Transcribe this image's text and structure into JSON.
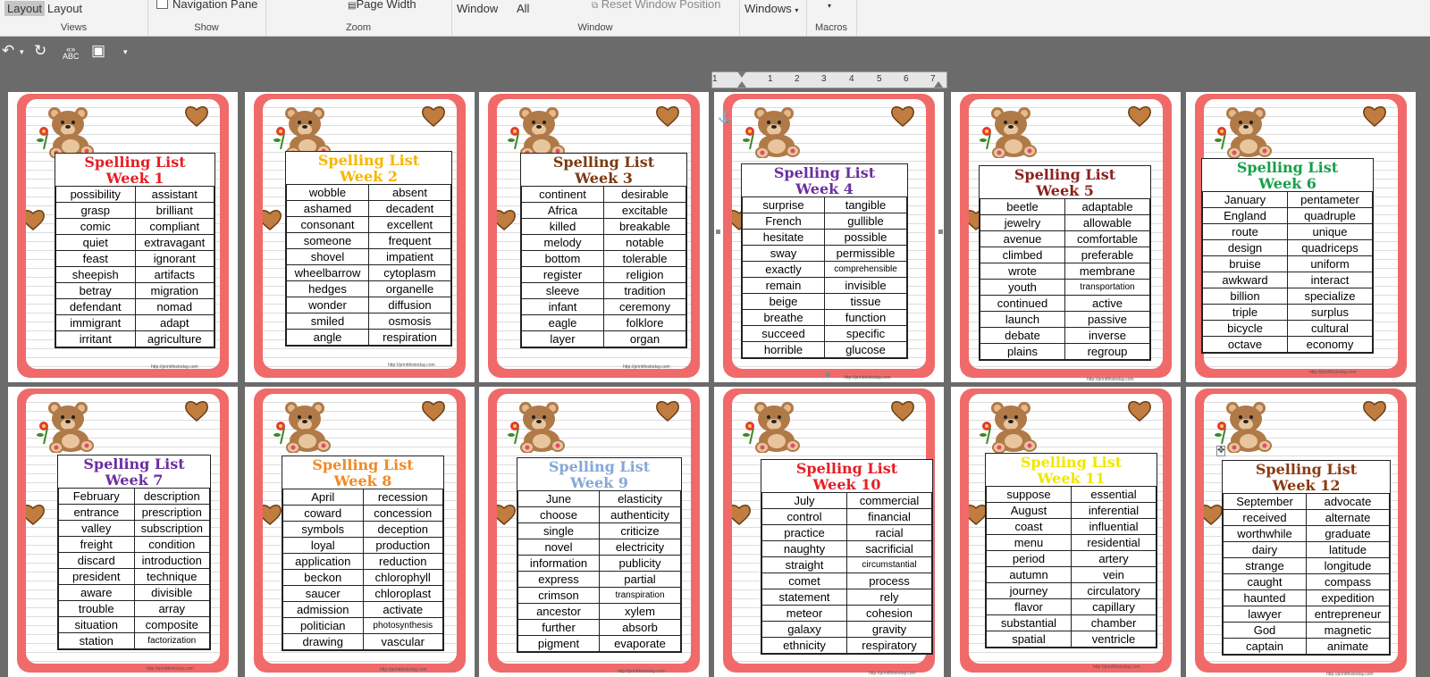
{
  "ribbon": {
    "views": {
      "label": "Views",
      "items": [
        "Layout",
        "Layout"
      ]
    },
    "show": {
      "label": "Show",
      "item": "Navigation Pane"
    },
    "zoom": {
      "label": "Zoom",
      "item": "Page Width"
    },
    "window": {
      "label": "Window",
      "items": [
        "Window",
        "All",
        "Reset Window Position"
      ]
    },
    "windows": {
      "label": "Windows"
    },
    "macros": {
      "label": "Macros"
    }
  },
  "qat": {
    "icons": [
      "undo-icon",
      "redo-icon",
      "spelling-icon",
      "paste-icon"
    ]
  },
  "ruler": {
    "ticks": [
      "1",
      "1",
      "2",
      "3",
      "4",
      "5",
      "6",
      "7"
    ]
  },
  "colors": {
    "page_frame": "#f06a6a",
    "background": "#6b6b6b"
  },
  "pages": [
    {
      "title1": "Spelling List",
      "title2": "Week 1",
      "color": "#e61e25",
      "words": [
        [
          "possibility",
          "assistant"
        ],
        [
          "grasp",
          "brilliant"
        ],
        [
          "comic",
          "compliant"
        ],
        [
          "quiet",
          "extravagant"
        ],
        [
          "feast",
          "ignorant"
        ],
        [
          "sheepish",
          "artifacts"
        ],
        [
          "betray",
          "migration"
        ],
        [
          "defendant",
          "nomad"
        ],
        [
          "immigrant",
          "adapt"
        ],
        [
          "irritant",
          "agriculture"
        ]
      ],
      "url": "http://printthistoday.com"
    },
    {
      "title1": "Spelling List",
      "title2": "Week 2",
      "color": "#f7b500",
      "words": [
        [
          "wobble",
          "absent"
        ],
        [
          "ashamed",
          "decadent"
        ],
        [
          "consonant",
          "excellent"
        ],
        [
          "someone",
          "frequent"
        ],
        [
          "shovel",
          "impatient"
        ],
        [
          "wheelbarrow",
          "cytoplasm"
        ],
        [
          "hedges",
          "organelle"
        ],
        [
          "wonder",
          "diffusion"
        ],
        [
          "smiled",
          "osmosis"
        ],
        [
          "angle",
          "respiration"
        ]
      ],
      "url": "http://printthistoday.com"
    },
    {
      "title1": "Spelling List",
      "title2": "Week 3",
      "color": "#7b3a10",
      "words": [
        [
          "continent",
          "desirable"
        ],
        [
          "Africa",
          "excitable"
        ],
        [
          "killed",
          "breakable"
        ],
        [
          "melody",
          "notable"
        ],
        [
          "bottom",
          "tolerable"
        ],
        [
          "register",
          "religion"
        ],
        [
          "sleeve",
          "tradition"
        ],
        [
          "infant",
          "ceremony"
        ],
        [
          "eagle",
          "folklore"
        ],
        [
          "layer",
          "organ"
        ]
      ],
      "url": "http://printthistoday.com"
    },
    {
      "title1": "Spelling List",
      "title2": "Week 4",
      "color": "#6b2fa0",
      "words": [
        [
          "surprise",
          "tangible"
        ],
        [
          "French",
          "gullible"
        ],
        [
          "hesitate",
          "possible"
        ],
        [
          "sway",
          "permissible"
        ],
        [
          "exactly",
          "comprehensible"
        ],
        [
          "remain",
          "invisible"
        ],
        [
          "beige",
          "tissue"
        ],
        [
          "breathe",
          "function"
        ],
        [
          "succeed",
          "specific"
        ],
        [
          "horrible",
          "glucose"
        ]
      ],
      "url": "http://printthistoday.com"
    },
    {
      "title1": "Spelling List",
      "title2": "Week 5",
      "color": "#8b2020",
      "words": [
        [
          "beetle",
          "adaptable"
        ],
        [
          "jewelry",
          "allowable"
        ],
        [
          "avenue",
          "comfortable"
        ],
        [
          "climbed",
          "preferable"
        ],
        [
          "wrote",
          "membrane"
        ],
        [
          "youth",
          "transportation"
        ],
        [
          "continued",
          "active"
        ],
        [
          "launch",
          "passive"
        ],
        [
          "debate",
          "inverse"
        ],
        [
          "plains",
          "regroup"
        ]
      ],
      "url": "http://printthistoday.com"
    },
    {
      "title1": "Spelling List",
      "title2": "Week 6",
      "color": "#15a04a",
      "words": [
        [
          "January",
          "pentameter"
        ],
        [
          "England",
          "quadruple"
        ],
        [
          "route",
          "unique"
        ],
        [
          "design",
          "quadriceps"
        ],
        [
          "bruise",
          "uniform"
        ],
        [
          "awkward",
          "interact"
        ],
        [
          "billion",
          "specialize"
        ],
        [
          "triple",
          "surplus"
        ],
        [
          "bicycle",
          "cultural"
        ],
        [
          "octave",
          "economy"
        ]
      ],
      "url": "http://printthistoday.com"
    },
    {
      "title1": "Spelling List",
      "title2": "Week 7",
      "color": "#6b2fa0",
      "words": [
        [
          "February",
          "description"
        ],
        [
          "entrance",
          "prescription"
        ],
        [
          "valley",
          "subscription"
        ],
        [
          "freight",
          "condition"
        ],
        [
          "discard",
          "introduction"
        ],
        [
          "president",
          "technique"
        ],
        [
          "aware",
          "divisible"
        ],
        [
          "trouble",
          "array"
        ],
        [
          "situation",
          "composite"
        ],
        [
          "station",
          "factorization"
        ]
      ],
      "url": "http://printthistoday.com"
    },
    {
      "title1": "Spelling List",
      "title2": "Week 8",
      "color": "#f08a24",
      "words": [
        [
          "April",
          "recession"
        ],
        [
          "coward",
          "concession"
        ],
        [
          "symbols",
          "deception"
        ],
        [
          "loyal",
          "production"
        ],
        [
          "application",
          "reduction"
        ],
        [
          "beckon",
          "chlorophyll"
        ],
        [
          "saucer",
          "chloroplast"
        ],
        [
          "admission",
          "activate"
        ],
        [
          "politician",
          "photosynthesis"
        ],
        [
          "drawing",
          "vascular"
        ]
      ],
      "url": "http://printthistoday.com"
    },
    {
      "title1": "Spelling List",
      "title2": "Week 9",
      "color": "#86a7d6",
      "words": [
        [
          "June",
          "elasticity"
        ],
        [
          "choose",
          "authenticity"
        ],
        [
          "single",
          "criticize"
        ],
        [
          "novel",
          "electricity"
        ],
        [
          "information",
          "publicity"
        ],
        [
          "express",
          "partial"
        ],
        [
          "crimson",
          "transpiration"
        ],
        [
          "ancestor",
          "xylem"
        ],
        [
          "further",
          "absorb"
        ],
        [
          "pigment",
          "evaporate"
        ]
      ],
      "url": "http://printthistoday.com"
    },
    {
      "title1": "Spelling List",
      "title2": "Week 10",
      "color": "#e61e25",
      "words": [
        [
          "July",
          "commercial"
        ],
        [
          "control",
          "financial"
        ],
        [
          "practice",
          "racial"
        ],
        [
          "naughty",
          "sacrificial"
        ],
        [
          "straight",
          "circumstantial"
        ],
        [
          "comet",
          "process"
        ],
        [
          "statement",
          "rely"
        ],
        [
          "meteor",
          "cohesion"
        ],
        [
          "galaxy",
          "gravity"
        ],
        [
          "ethnicity",
          "respiratory"
        ]
      ],
      "url": "http://printthistoday.com"
    },
    {
      "title1": "Spelling List",
      "title2": "Week 11",
      "color": "#f2e600",
      "words": [
        [
          "suppose",
          "essential"
        ],
        [
          "August",
          "inferential"
        ],
        [
          "coast",
          "influential"
        ],
        [
          "menu",
          "residential"
        ],
        [
          "period",
          "artery"
        ],
        [
          "autumn",
          "vein"
        ],
        [
          "journey",
          "circulatory"
        ],
        [
          "flavor",
          "capillary"
        ],
        [
          "substantial",
          "chamber"
        ],
        [
          "spatial",
          "ventricle"
        ]
      ],
      "url": "http://printthistoday.com"
    },
    {
      "title1": "Spelling List",
      "title2": "Week 12",
      "color": "#8b3a10",
      "words": [
        [
          "September",
          "advocate"
        ],
        [
          "received",
          "alternate"
        ],
        [
          "worthwhile",
          "graduate"
        ],
        [
          "dairy",
          "latitude"
        ],
        [
          "strange",
          "longitude"
        ],
        [
          "caught",
          "compass"
        ],
        [
          "haunted",
          "expedition"
        ],
        [
          "lawyer",
          "entrepreneur"
        ],
        [
          "God",
          "magnetic"
        ],
        [
          "captain",
          "animate"
        ]
      ],
      "url": "http://printthistoday.com"
    }
  ]
}
